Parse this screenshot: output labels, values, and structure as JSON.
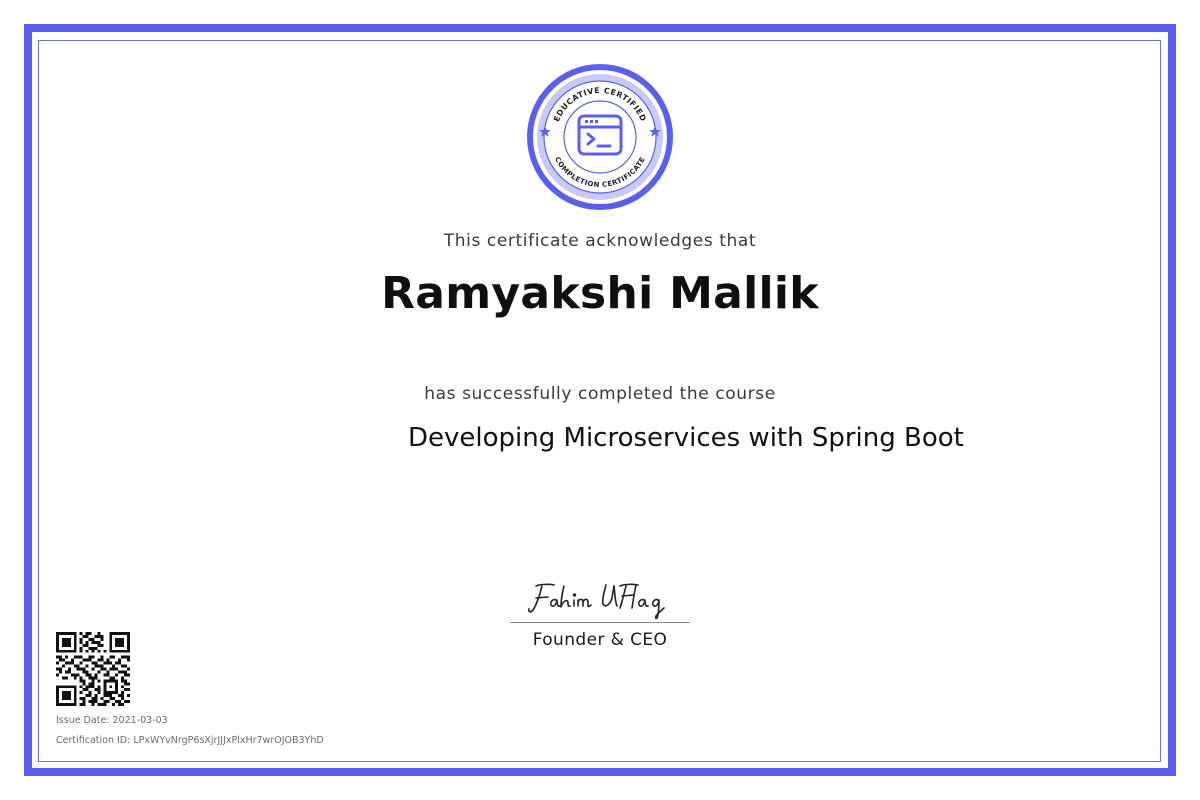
{
  "badge": {
    "top_text": "EDUCATIVE CERTIFIED",
    "bottom_text": "COMPLETION CERTIFICATE",
    "icon": "terminal-window-icon"
  },
  "certificate": {
    "ack_text": "This certificate acknowledges that",
    "recipient": "Ramyakshi Mallik",
    "completed_text": "has successfully completed the course",
    "course": "Developing Microservices with Spring Boot"
  },
  "signatory": {
    "signature": "Fahim Ul Haq",
    "title": "Founder & CEO"
  },
  "meta": {
    "issue_date": "Issue Date: 2021-03-03",
    "certification_id": "Certification ID: LPxWYvNrgP6sXjrJJJxPlxHr7wrOJOB3YhD"
  },
  "colors": {
    "accent": "#5a5ff0",
    "accent_light": "#c9caf8"
  }
}
